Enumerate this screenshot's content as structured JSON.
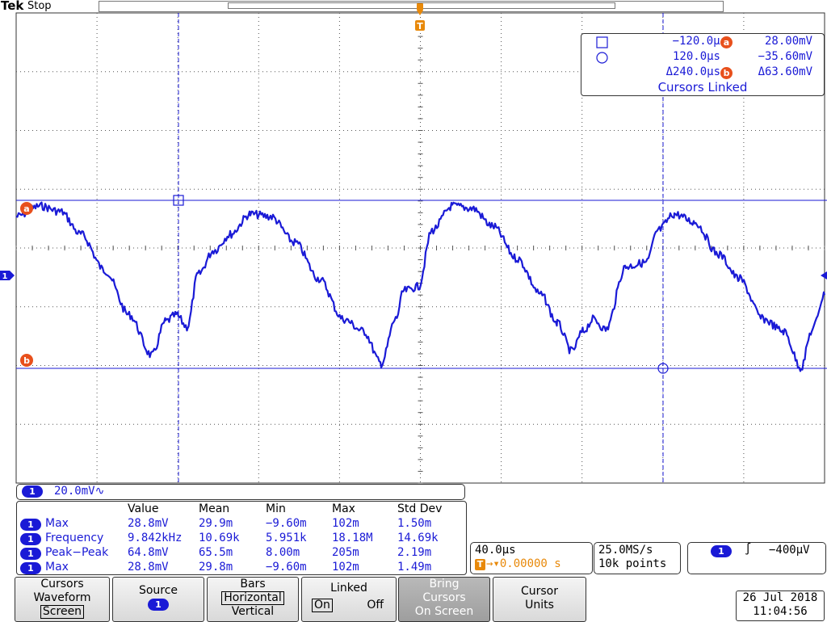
{
  "header": {
    "brand": "Tek",
    "status": "Stop",
    "trigger_marker": "T"
  },
  "markers": {
    "channel": "1",
    "cursor_a": "a",
    "cursor_b": "b",
    "trigger_label": "T"
  },
  "cursor_readout": {
    "t1": "−120.0µs",
    "v1": "28.00mV",
    "t2": "120.0µs",
    "v2": "−35.60mV",
    "dt": "Δ240.0µs",
    "dv": "Δ63.60mV",
    "linked": "Cursors Linked"
  },
  "channel_scale": {
    "channel": "1",
    "text": "20.0mV∿"
  },
  "measurements": {
    "headers": [
      "Value",
      "Mean",
      "Min",
      "Max",
      "Std Dev"
    ],
    "rows": [
      {
        "channel": "1",
        "name": "Max",
        "value": "28.8mV",
        "mean": "29.9m",
        "min": "−9.60m",
        "max": "102m",
        "std": "1.50m"
      },
      {
        "channel": "1",
        "name": "Frequency",
        "value": "9.842kHz",
        "mean": "10.69k",
        "min": "5.951k",
        "max": "18.18M",
        "std": "14.69k"
      },
      {
        "channel": "1",
        "name": "Peak−Peak",
        "value": "64.8mV",
        "mean": "65.5m",
        "min": "8.00m",
        "max": "205m",
        "std": "2.19m"
      },
      {
        "channel": "1",
        "name": "Max",
        "value": "28.8mV",
        "mean": "29.8m",
        "min": "−9.60m",
        "max": "102m",
        "std": "1.49m"
      }
    ]
  },
  "horizontal": {
    "scale": "40.0µs",
    "trigger_symbol": "T",
    "delay": "→▾0.00000 s"
  },
  "acquisition": {
    "rate": "25.0MS/s",
    "record": "10k points"
  },
  "trigger": {
    "channel": "1",
    "slope": "∫",
    "level": "−400µV"
  },
  "menu": {
    "cursors": {
      "line1": "Cursors",
      "line2": "Waveform",
      "line3": "Screen"
    },
    "source": {
      "line1": "Source",
      "channel": "1"
    },
    "bars": {
      "line1": "Bars",
      "line2": "Horizontal",
      "line3": "Vertical"
    },
    "linked": {
      "line1": "Linked",
      "on": "On",
      "off": "Off"
    },
    "bring": {
      "line1": "Bring",
      "line2": "Cursors",
      "line3": "On Screen"
    },
    "units": {
      "line1": "Cursor",
      "line2": "Units"
    }
  },
  "datetime": {
    "date": "26 Jul  2018",
    "time": "11:04:56"
  },
  "colors": {
    "trace": "#1a1ad6",
    "cursor_badge": "#e8501c",
    "trigger": "#e8890a",
    "grid": "#333333"
  }
}
